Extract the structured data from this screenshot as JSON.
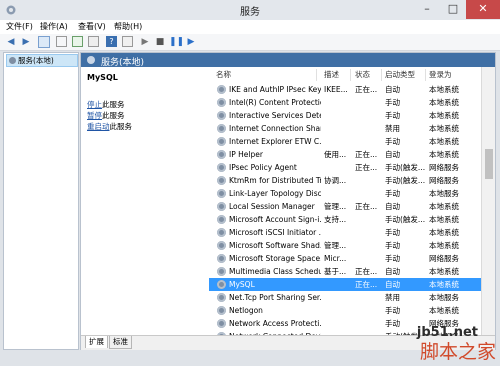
{
  "window": {
    "title": "服务"
  },
  "menu": [
    "文件(F)",
    "操作(A)",
    "查看(V)",
    "帮助(H)"
  ],
  "tree": {
    "item": "服务(本地)"
  },
  "header": {
    "title": "服务(本地)"
  },
  "description": {
    "service_name": "MySQL",
    "links": [
      {
        "link": "停止",
        "rest": "此服务"
      },
      {
        "link": "暂停",
        "rest": "此服务"
      },
      {
        "link": "重启动",
        "rest": "此服务"
      }
    ]
  },
  "columns": [
    "名称",
    "描述",
    "状态",
    "启动类型",
    "登录为"
  ],
  "rows": [
    {
      "name": "IKE and AuthIP IPsec Key...",
      "desc": "IKEE...",
      "status": "正在...",
      "startup": "自动",
      "logon": "本地系统"
    },
    {
      "name": "Intel(R) Content Protectio...",
      "desc": "",
      "status": "",
      "startup": "手动",
      "logon": "本地系统"
    },
    {
      "name": "Interactive Services Dete...",
      "desc": "",
      "status": "",
      "startup": "手动",
      "logon": "本地系统"
    },
    {
      "name": "Internet Connection Shari...",
      "desc": "",
      "status": "",
      "startup": "禁用",
      "logon": "本地系统"
    },
    {
      "name": "Internet Explorer ETW C...",
      "desc": "",
      "status": "",
      "startup": "手动",
      "logon": "本地系统"
    },
    {
      "name": "IP Helper",
      "desc": "使用...",
      "status": "正在...",
      "startup": "自动",
      "logon": "本地系统"
    },
    {
      "name": "IPsec Policy Agent",
      "desc": "",
      "status": "正在...",
      "startup": "手动(触发...",
      "logon": "网络服务"
    },
    {
      "name": "KtmRm for Distributed Tr...",
      "desc": "协调...",
      "status": "",
      "startup": "手动(触发...",
      "logon": "网络服务"
    },
    {
      "name": "Link-Layer Topology Disc...",
      "desc": "",
      "status": "",
      "startup": "手动",
      "logon": "本地服务"
    },
    {
      "name": "Local Session Manager",
      "desc": "管理...",
      "status": "正在...",
      "startup": "自动",
      "logon": "本地系统"
    },
    {
      "name": "Microsoft Account Sign-i...",
      "desc": "支持...",
      "status": "",
      "startup": "手动(触发...",
      "logon": "本地系统"
    },
    {
      "name": "Microsoft iSCSI Initiator ...",
      "desc": "",
      "status": "",
      "startup": "手动",
      "logon": "本地系统"
    },
    {
      "name": "Microsoft Software Shad...",
      "desc": "管理...",
      "status": "",
      "startup": "手动",
      "logon": "本地系统"
    },
    {
      "name": "Microsoft Storage Space...",
      "desc": "Micr...",
      "status": "",
      "startup": "手动",
      "logon": "网络服务"
    },
    {
      "name": "Multimedia Class Schedul...",
      "desc": "基于...",
      "status": "正在...",
      "startup": "自动",
      "logon": "本地系统"
    },
    {
      "name": "MySQL",
      "desc": "",
      "status": "正在...",
      "startup": "自动",
      "logon": "本地系统"
    },
    {
      "name": "Net.Tcp Port Sharing Ser...",
      "desc": "",
      "status": "",
      "startup": "禁用",
      "logon": "本地服务"
    },
    {
      "name": "Netlogon",
      "desc": "",
      "status": "",
      "startup": "手动",
      "logon": "本地系统"
    },
    {
      "name": "Network Access Protecti...",
      "desc": "",
      "status": "",
      "startup": "手动",
      "logon": "网络服务"
    },
    {
      "name": "Network Connected Devi...",
      "desc": "",
      "status": "",
      "startup": "手动(触发...",
      "logon": "本地服务"
    }
  ],
  "selected_row": "MySQL",
  "tabs": [
    "扩展",
    "标准"
  ],
  "watermark": {
    "brand": "jb51.net",
    "name": "脚本之家"
  },
  "colors": {
    "header": "#3f6fa5",
    "selection": "#3399ff",
    "close": "#c74949"
  }
}
